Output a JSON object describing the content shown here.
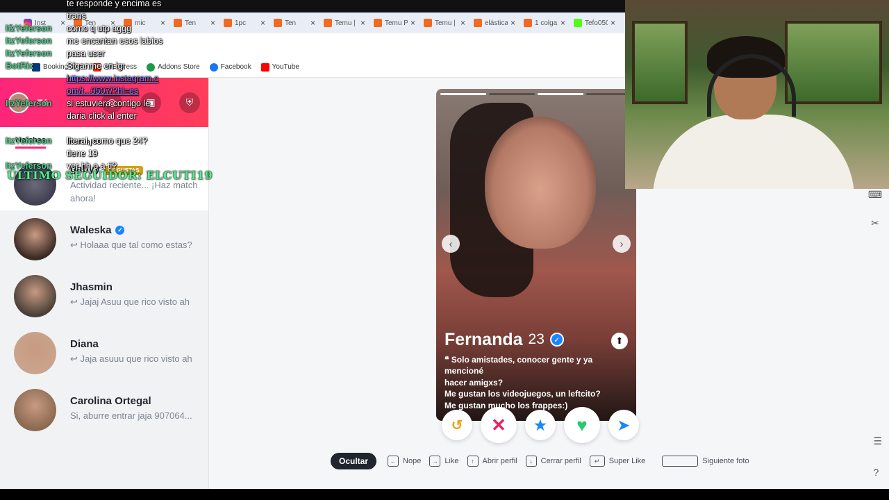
{
  "tabs": [
    {
      "label": "Inst",
      "fav": "ig"
    },
    {
      "label": "Ten",
      "fav": "temu"
    },
    {
      "label": "mic",
      "fav": "temu"
    },
    {
      "label": "Ten",
      "fav": "temu"
    },
    {
      "label": "1pc",
      "fav": "temu"
    },
    {
      "label": "Ten",
      "fav": "temu"
    },
    {
      "label": "Temu | C",
      "fav": "temu"
    },
    {
      "label": "Temu Pe",
      "fav": "temu"
    },
    {
      "label": "Temu | C",
      "fav": "temu"
    },
    {
      "label": "elástica",
      "fav": "temu"
    },
    {
      "label": "1 colga",
      "fav": "temu"
    },
    {
      "label": "Tefo050",
      "fav": "k"
    }
  ],
  "bookmarks": [
    "Booking.com",
    "AliExpress",
    "Addons Store",
    "Facebook",
    "YouTube"
  ],
  "sidebar": {
    "me_label": "Tú",
    "tabs": {
      "matches": "Matches",
      "messages": "Mensajes"
    },
    "first_match": {
      "name": "gabyy",
      "badge": "LE GUSTAS",
      "line1": "Actividad reciente... ¡Haz match",
      "line2": "ahora!"
    },
    "conversations": [
      {
        "name": "Waleska",
        "verified": true,
        "msg": "↩ Holaaa que tal como estas?",
        "color": "#3a2a24"
      },
      {
        "name": "Jhasmin",
        "verified": false,
        "msg": "↩ Jajaj Asuu que rico visto ah",
        "color": "#4a4038"
      },
      {
        "name": "Diana",
        "verified": false,
        "msg": "↩ Jaja asuuu que rico visto ah",
        "color": "#c9a48c"
      },
      {
        "name": "Carolina Ortegal",
        "verified": false,
        "msg": "Si, aburre entrar jaja 907064...",
        "color": "#8a6a50"
      }
    ]
  },
  "card": {
    "name": "Fernanda",
    "age": "23",
    "bio_lines": [
      "❝ Solo amistades, conocer gente y ya mencioné",
      "hacer amigxs?",
      "Me gustan los videojuegos, un leftcito?",
      "Me gustan mucho los frappes:)"
    ]
  },
  "actions": {
    "rewind": "↺",
    "nope": "✕",
    "superlike": "★",
    "like": "♥",
    "boost": "➤"
  },
  "hints": {
    "hide": "Ocultar",
    "nope": "Nope",
    "like": "Like",
    "open": "Abrir perfil",
    "close": "Cerrar perfil",
    "superlike": "Super Like",
    "next": "Siguiente foto"
  },
  "chat": [
    {
      "user": "",
      "text": "te responde y encima es"
    },
    {
      "user": "",
      "text": "trans"
    },
    {
      "user": "ItzYeferson",
      "text": "como q utp aggg"
    },
    {
      "user": "ItzYeferson",
      "text": "me encantan esos labios"
    },
    {
      "user": "ItzYeferson",
      "text": "pasa user"
    },
    {
      "user": "BotRix",
      "text": "Síganme en ig:"
    },
    {
      "user": "",
      "text": "https://www.instagram.c",
      "link": true
    },
    {
      "user": "",
      "text": "om/t...0507/?hl=es",
      "link": true
    },
    {
      "user": "ItzYeferson",
      "text": "si estuviera contigo le"
    },
    {
      "user": "",
      "text": "daria click al enter"
    },
    {
      "user": "",
      "text": ""
    },
    {
      "user": "ItzYeferson",
      "text": "literal, como que 24?"
    },
    {
      "user": "",
      "text": "tiene 19"
    },
    {
      "user": "ItzYeferson",
      "text": "ver hh o a ti?"
    }
  ],
  "follower_banner": "ÚLTIMO SEGUIDOR: ELCUTI19",
  "colors": {
    "brand_start": "#fd267a",
    "brand_end": "#ff3d5a",
    "nope": "#e5245e",
    "like": "#27c971",
    "super": "#1786ff"
  }
}
